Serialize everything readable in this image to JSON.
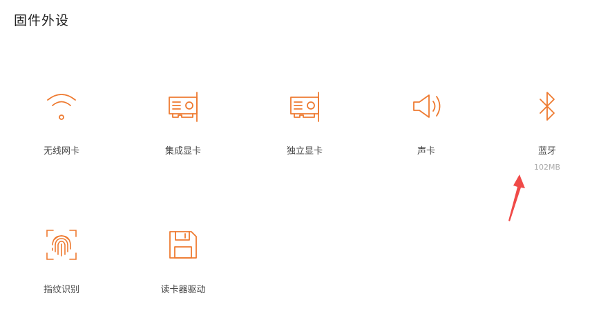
{
  "page": {
    "title": "固件外设"
  },
  "colors": {
    "accent": "#ee7a30",
    "annotation": "#f04a48"
  },
  "devices": [
    {
      "label": "无线网卡",
      "icon": "wifi-icon"
    },
    {
      "label": "集成显卡",
      "icon": "graphics-card-icon"
    },
    {
      "label": "独立显卡",
      "icon": "graphics-card-icon"
    },
    {
      "label": "声卡",
      "icon": "speaker-icon"
    },
    {
      "label": "蓝牙",
      "icon": "bluetooth-icon",
      "size": "102MB"
    },
    {
      "label": "指纹识别",
      "icon": "fingerprint-icon"
    },
    {
      "label": "读卡器驱动",
      "icon": "floppy-disk-icon"
    }
  ]
}
